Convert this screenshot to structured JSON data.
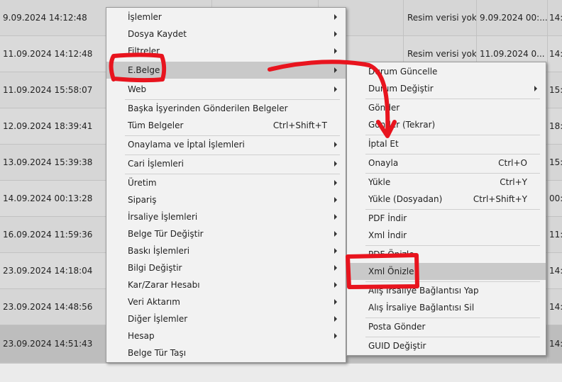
{
  "grid": {
    "rows": [
      {
        "date": "9.09.2024 14:12:48",
        "image": "Resim verisi yok",
        "date2": "9.09.2024 00:...",
        "last": "14:"
      },
      {
        "date": "11.09.2024 14:12:48",
        "image": "Resim verisi yok",
        "date2": "11.09.2024 0...",
        "last": "14:"
      },
      {
        "date": "11.09.2024 15:58:07",
        "image": "",
        "date2": "",
        "last": "15:"
      },
      {
        "date": "12.09.2024 18:39:41",
        "image": "",
        "date2": "",
        "last": "18:"
      },
      {
        "date": "13.09.2024 15:39:38",
        "image": "",
        "date2": "",
        "last": "15:"
      },
      {
        "date": "14.09.2024 00:13:28",
        "image": "",
        "date2": "",
        "last": "00:"
      },
      {
        "date": "16.09.2024 11:59:36",
        "image": "",
        "date2": "",
        "last": "11:"
      },
      {
        "date": "23.09.2024 14:18:04",
        "image": "",
        "date2": "",
        "last": "14:"
      },
      {
        "date": "23.09.2024 14:48:56",
        "image": "",
        "date2": "",
        "last": "14:"
      },
      {
        "date": "23.09.2024 14:51:43",
        "image": "",
        "date2": "",
        "last": "14:"
      }
    ]
  },
  "main_menu": {
    "items": [
      {
        "label": "İşlemler",
        "submenu": true
      },
      {
        "label": "Dosya Kaydet",
        "submenu": true
      },
      {
        "label": "Filtreler",
        "submenu": true
      },
      {
        "label": "E.Belge",
        "submenu": true,
        "highlighted": true
      },
      {
        "label": "Web",
        "submenu": true
      },
      {
        "label": "Başka İşyerinden Gönderilen Belgeler",
        "submenu": false
      },
      {
        "label": "Tüm Belgeler",
        "shortcut": "Ctrl+Shift+T",
        "submenu": false
      },
      {
        "label": "Onaylama ve İptal İşlemleri",
        "submenu": true
      },
      {
        "label": "Cari İşlemleri",
        "submenu": true
      },
      {
        "label": "Üretim",
        "submenu": true
      },
      {
        "label": "Sipariş",
        "submenu": true
      },
      {
        "label": "İrsaliye İşlemleri",
        "submenu": true
      },
      {
        "label": "Belge Tür Değiştir",
        "submenu": true
      },
      {
        "label": "Baskı İşlemleri",
        "submenu": true
      },
      {
        "label": "Bilgi Değiştir",
        "submenu": true
      },
      {
        "label": "Kar/Zarar Hesabı",
        "submenu": true
      },
      {
        "label": "Veri Aktarım",
        "submenu": true
      },
      {
        "label": "Diğer İşlemler",
        "submenu": true
      },
      {
        "label": "Hesap",
        "submenu": true
      },
      {
        "label": "Belge Tür Taşı",
        "submenu": false
      }
    ]
  },
  "sub_menu": {
    "items": [
      {
        "label": "Durum Güncelle"
      },
      {
        "label": "Durum Değiştir",
        "submenu": true
      },
      {
        "label": "Gönder"
      },
      {
        "label": "Gönder (Tekrar)"
      },
      {
        "label": "İptal Et"
      },
      {
        "label": "Onayla",
        "shortcut": "Ctrl+O"
      },
      {
        "label": "Yükle",
        "shortcut": "Ctrl+Y"
      },
      {
        "label": "Yükle (Dosyadan)",
        "shortcut": "Ctrl+Shift+Y"
      },
      {
        "label": "PDF İndir"
      },
      {
        "label": "Xml İndir"
      },
      {
        "label": "PDF Önizle"
      },
      {
        "label": "Xml Önizle",
        "highlighted": true
      },
      {
        "label": "Alış İrsaliye Bağlantısı Yap"
      },
      {
        "label": "Alış İrsaliye Bağlantısı Sil"
      },
      {
        "label": "Posta Gönder"
      },
      {
        "label": "GUID Değiştir"
      }
    ]
  },
  "colors": {
    "annotation": "#e8141e",
    "highlight": "#c9c9c9",
    "menu_bg": "#f2f2f2"
  }
}
